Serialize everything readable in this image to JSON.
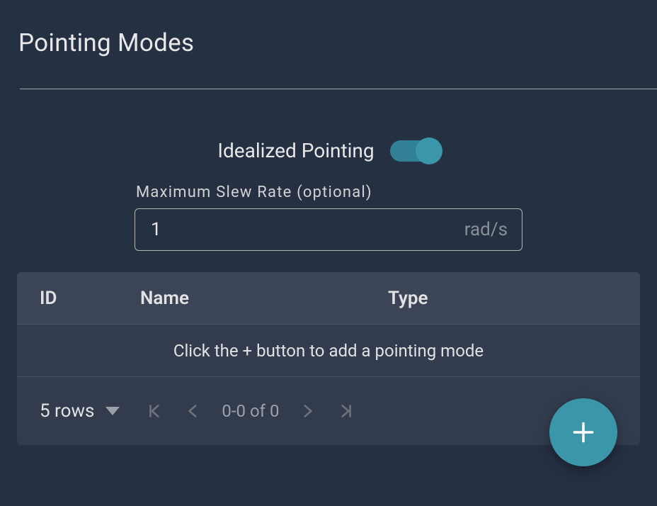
{
  "header": {
    "title": "Pointing Modes"
  },
  "toggle": {
    "label": "Idealized Pointing",
    "state": "on"
  },
  "slew": {
    "label": "Maximum Slew Rate (optional)",
    "value": "1",
    "unit": "rad/s"
  },
  "table": {
    "columns": {
      "id": "ID",
      "name": "Name",
      "type": "Type"
    },
    "empty_message": "Click the + button to add a pointing mode",
    "footer": {
      "rows_label": "5 rows",
      "range": "0-0 of 0"
    }
  },
  "fab": {
    "add_label": "+"
  }
}
